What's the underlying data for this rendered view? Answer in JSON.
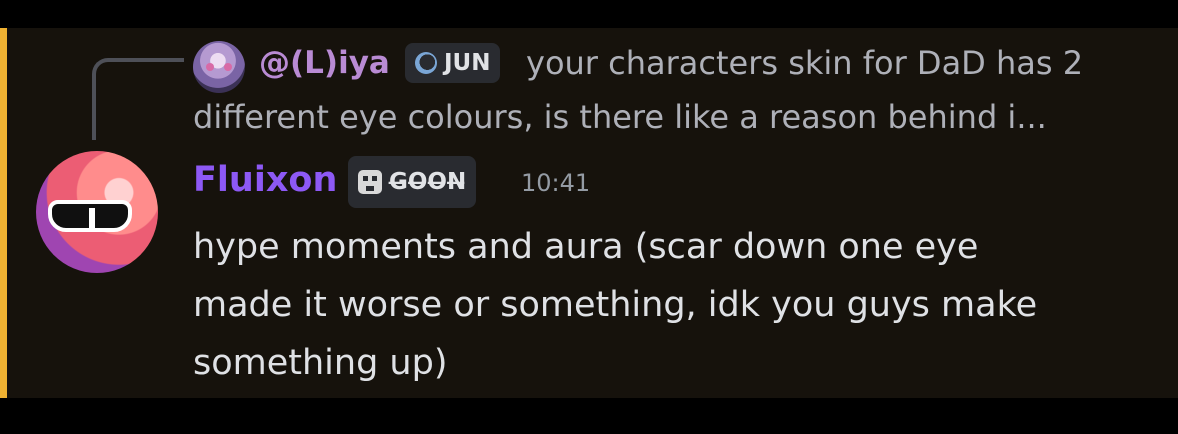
{
  "reply": {
    "author": "@(L)iya",
    "badge": "JUN",
    "line1": "your characters skin for DaD has 2",
    "line2": "different eye colours, is there like a reason behind i..."
  },
  "message": {
    "author": "Fluixon",
    "badge": "G̶O̶O̶N̶",
    "time": "10:41",
    "lines": [
      "hype moments and aura (scar down one eye",
      "made it worse or something, idk you guys make",
      "something up)"
    ]
  },
  "colors": {
    "accent": "#f0b232",
    "author": "#8d59f5",
    "reply_author": "#b98bd4"
  },
  "icons": {
    "reply_badge": "moon-icon",
    "author_badge": "skull-icon"
  }
}
